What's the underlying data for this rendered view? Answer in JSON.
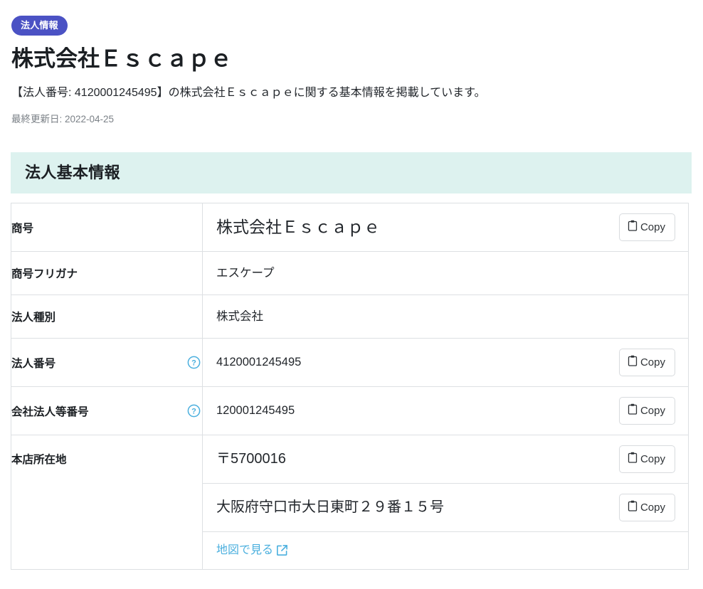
{
  "header": {
    "badge": "法人情報",
    "title": "株式会社Ｅｓｃａｐｅ",
    "description": "【法人番号: 4120001245495】の株式会社Ｅｓｃａｐｅに関する基本情報を掲載しています。",
    "updated": "最終更新日: 2022-04-25"
  },
  "section": {
    "heading": "法人基本情報"
  },
  "labels": {
    "copy": "Copy",
    "map_link": "地図で見る"
  },
  "rows": [
    {
      "label": "商号",
      "has_help": false,
      "value": "株式会社Ｅｓｃａｐｅ",
      "has_copy": true,
      "size": "big"
    },
    {
      "label": "商号フリガナ",
      "has_help": false,
      "value": "エスケープ",
      "has_copy": false,
      "size": "normal"
    },
    {
      "label": "法人種別",
      "has_help": false,
      "value": "株式会社",
      "has_copy": false,
      "size": "normal"
    },
    {
      "label": "法人番号",
      "has_help": true,
      "value": "4120001245495",
      "has_copy": true,
      "size": "normal"
    },
    {
      "label": "会社法人等番号",
      "has_help": true,
      "value": "120001245495",
      "has_copy": true,
      "size": "normal"
    }
  ],
  "address_row": {
    "label": "本店所在地",
    "postal_code": "〒5700016",
    "address": "大阪府守口市大日東町２９番１５号",
    "map_link": "地図で見る"
  },
  "colors": {
    "badge_bg": "#4b52c4",
    "section_bg": "#ddf2ef",
    "link": "#4aafde",
    "help_icon": "#4aafde",
    "border": "#dde0e3",
    "muted_text": "#7b8187"
  }
}
